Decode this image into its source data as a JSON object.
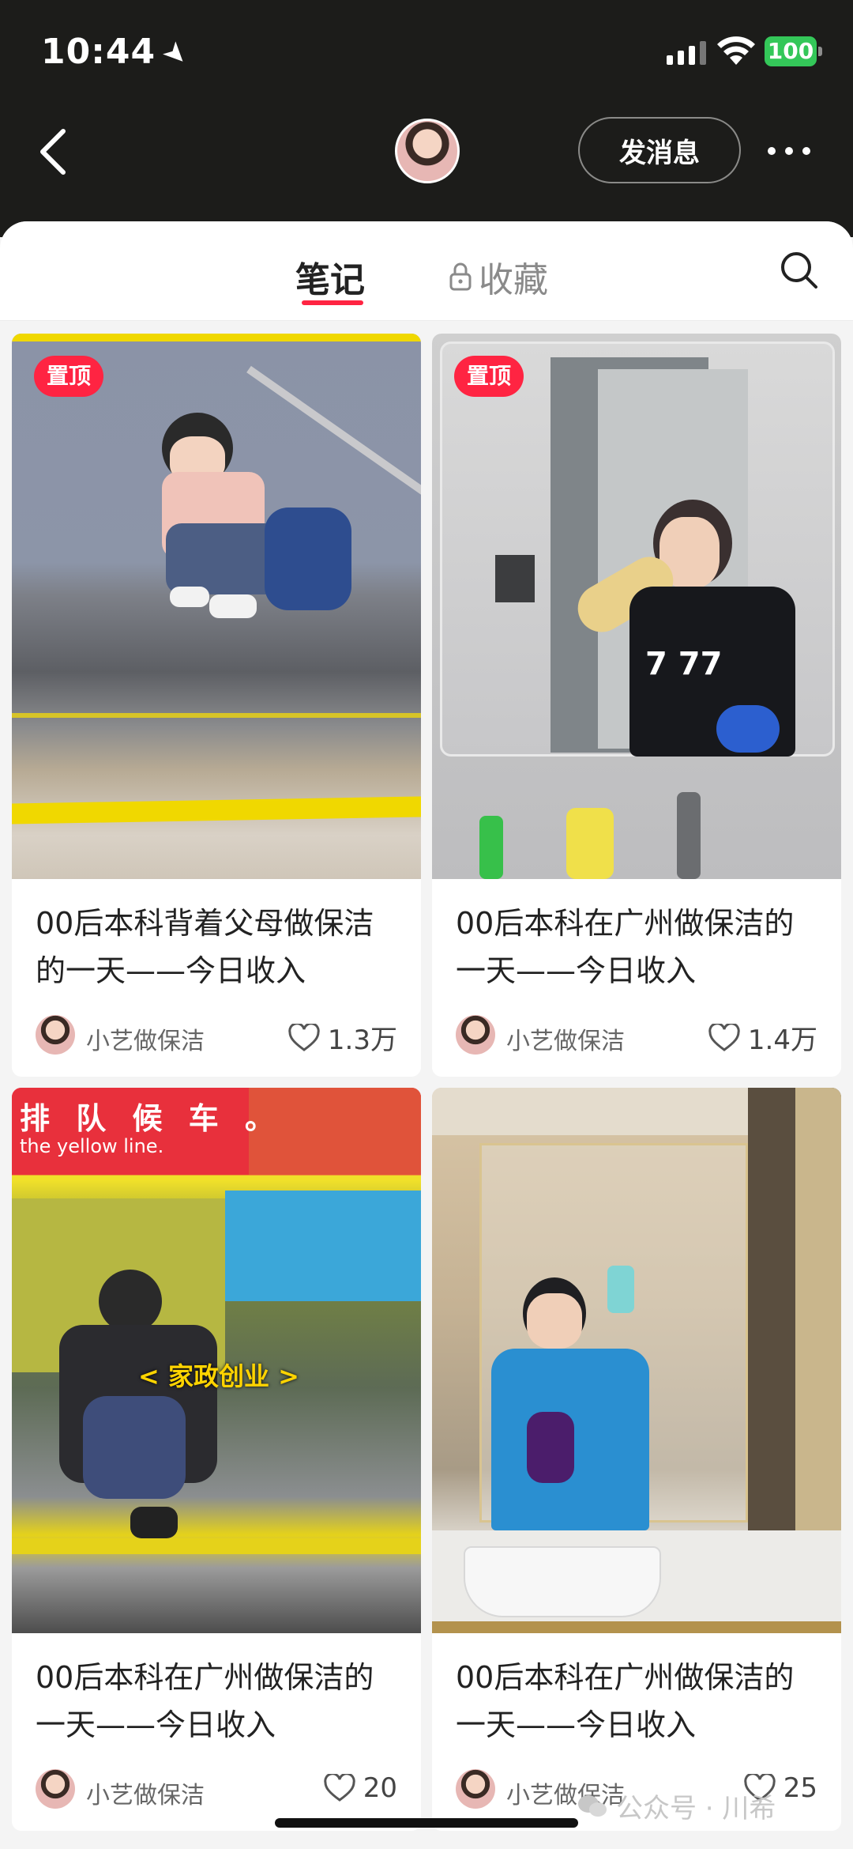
{
  "status": {
    "time": "10:44",
    "battery": "100"
  },
  "header": {
    "message_button": "发消息"
  },
  "tabs": {
    "notes": "笔记",
    "collections": "收藏"
  },
  "cards": [
    {
      "pinned": "置顶",
      "title": "00后本科背着父母做保洁的一天——今日收入",
      "author": "小艺做保洁",
      "likes": "1.3万"
    },
    {
      "pinned": "置顶",
      "title": "00后本科在广州做保洁的一天——今日收入",
      "author": "小艺做保洁",
      "likes": "1.4万"
    },
    {
      "title": "00后本科在广州做保洁的一天——今日收入",
      "author": "小艺做保洁",
      "likes": "20",
      "overlay_caption": "< 家政创业 >",
      "sign_text": "排 队 候 车 。",
      "sign_sub": "the yellow line."
    },
    {
      "title": "00后本科在广州做保洁的一天——今日收入",
      "author": "小艺做保洁",
      "likes": "25"
    }
  ],
  "watermark": "公众号 · 川希",
  "colors": {
    "accent": "#ff2442",
    "topbar": "#1c1c1a",
    "battery": "#34c759"
  },
  "icons": [
    "back-icon",
    "more-icon",
    "lock-icon",
    "search-icon",
    "heart-icon"
  ]
}
